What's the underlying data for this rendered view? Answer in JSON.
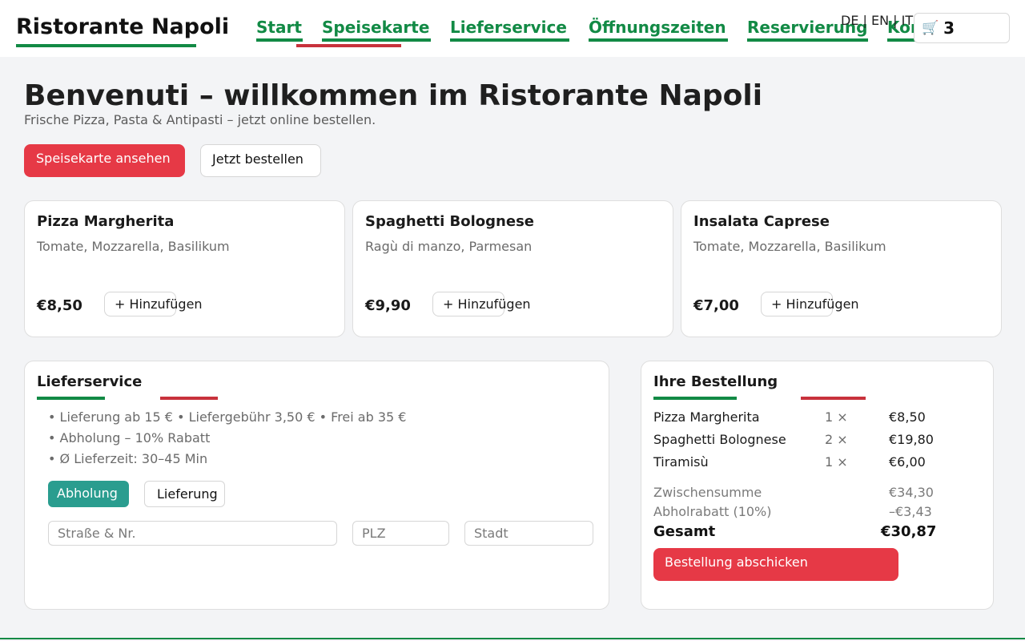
{
  "header": {
    "brand": "Ristorante Napoli",
    "nav": [
      {
        "label": "Start"
      },
      {
        "label": "Speisekarte"
      },
      {
        "label": "Lieferservice"
      },
      {
        "label": "Öffnungszeiten"
      },
      {
        "label": "Reservierung"
      },
      {
        "label": "Kontakt"
      }
    ],
    "languages": "DE | EN | IT",
    "cart": {
      "icon": "shopping-cart-icon",
      "count": "3"
    }
  },
  "hero": {
    "title": "Benvenuti – willkommen im Ristorante Napoli",
    "subtitle": "Frische Pizza, Pasta & Antipasti – jetzt online bestellen.",
    "primary_button": "Speisekarte ansehen",
    "secondary_button": "Jetzt bestellen"
  },
  "menu": {
    "add_label": "+ Hinzufügen",
    "items": [
      {
        "name": "Pizza Margherita",
        "description": "Tomate, Mozzarella, Basilikum",
        "price": "€8,50"
      },
      {
        "name": "Spaghetti Bolognese",
        "description": "Ragù di manzo, Parmesan",
        "price": "€9,90"
      },
      {
        "name": "Insalata Caprese",
        "description": "Tomate, Mozzarella, Basilikum",
        "price": "€7,00"
      }
    ]
  },
  "delivery": {
    "title": "Lieferservice",
    "info": [
      "• Lieferung ab 15 € • Liefergebühr 3,50 € • Frei ab 35 €",
      "• Abholung – 10% Rabatt",
      "• Ø Lieferzeit: 30–45 Min"
    ],
    "mode_pickup": "Abholung",
    "mode_delivery": "Lieferung",
    "selected_mode": "Abholung",
    "street_placeholder": "Straße & Nr.",
    "zip_placeholder": "PLZ",
    "city_placeholder": "Stadt"
  },
  "order": {
    "title": "Ihre Bestellung",
    "items": [
      {
        "name": "Pizza Margherita",
        "qty": "1 ×",
        "price": "€8,50"
      },
      {
        "name": "Spaghetti Bolognese",
        "qty": "2 ×",
        "price": "€19,80"
      },
      {
        "name": "Tiramisù",
        "qty": "1 ×",
        "price": "€6,00"
      }
    ],
    "subtotal_label": "Zwischensumme",
    "subtotal": "€34,30",
    "discount_label": "Abholrabatt (10%)",
    "discount": "–€3,43",
    "total_label": "Gesamt",
    "total": "€30,87",
    "submit": "Bestellung abschicken"
  },
  "colors": {
    "brand_green": "#128a45",
    "accent_red": "#e63946",
    "teal": "#2a9d8f",
    "stripe_red": "#c8323c"
  }
}
